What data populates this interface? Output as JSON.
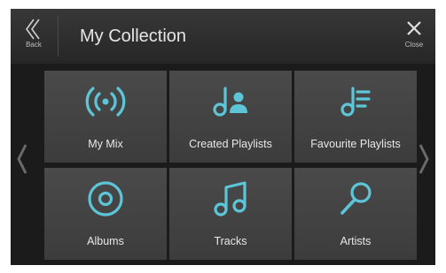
{
  "header": {
    "back_label": "Back",
    "title": "My Collection",
    "close_label": "Close"
  },
  "tiles": [
    {
      "label": "My Mix",
      "icon": "broadcast-icon"
    },
    {
      "label": "Created Playlists",
      "icon": "playlist-user-icon"
    },
    {
      "label": "Favourite Playlists",
      "icon": "playlist-icon"
    },
    {
      "label": "Albums",
      "icon": "album-disc-icon"
    },
    {
      "label": "Tracks",
      "icon": "music-notes-icon"
    },
    {
      "label": "Artists",
      "icon": "microphone-icon"
    }
  ],
  "colors": {
    "accent": "#5cc6d8",
    "tile": "#444444",
    "background": "#1b1b1b"
  }
}
